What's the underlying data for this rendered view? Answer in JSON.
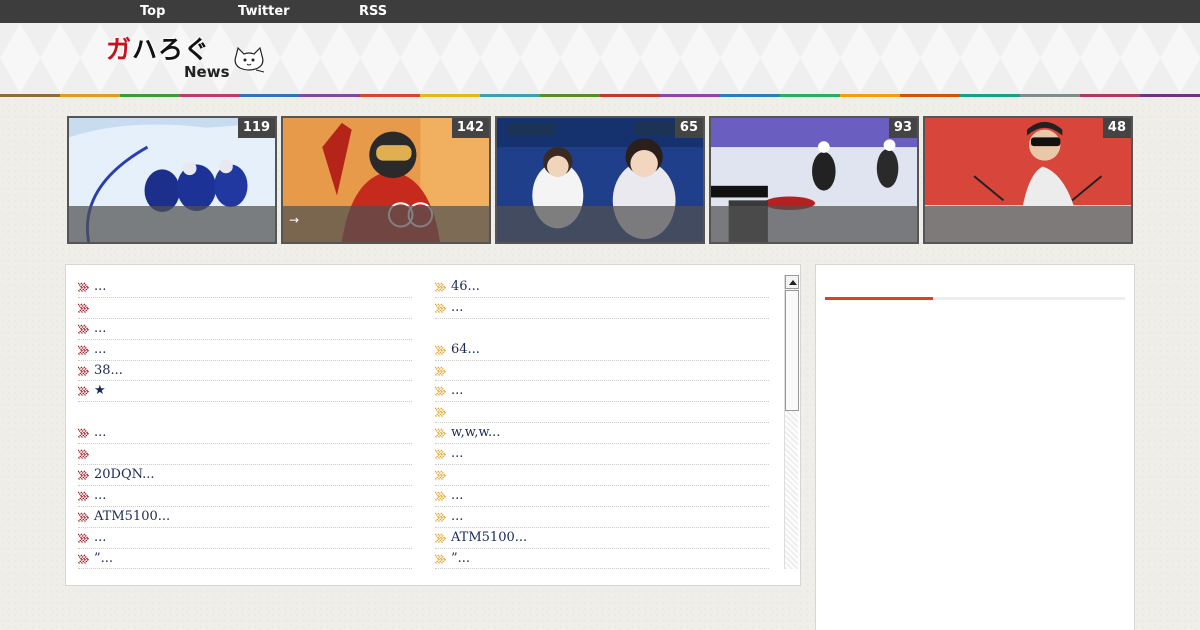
{
  "nav": {
    "items": [
      "Top",
      "Twitter",
      "RSS"
    ]
  },
  "logo": {
    "main_red": "ガ",
    "main_rest": "ハろぐ",
    "sub": "News"
  },
  "featured": [
    {
      "count": "119",
      "caption": ""
    },
    {
      "count": "142",
      "caption": "→"
    },
    {
      "count": "65",
      "caption": ""
    },
    {
      "count": "93",
      "caption": ""
    },
    {
      "count": "48",
      "caption": ""
    }
  ],
  "list": {
    "left": [
      "...",
      "",
      "...",
      "...",
      "38...",
      "★",
      "",
      "...",
      "",
      "20DQN...",
      "...",
      "ATM5100...",
      "...",
      "”..."
    ],
    "right": [
      "46...",
      "...",
      "",
      "64...",
      "",
      "...",
      "",
      "w,w,w...",
      "...",
      "",
      "...",
      "...",
      "ATM5100...",
      "”..."
    ]
  },
  "colors": {
    "left_arrow": "#a0141f",
    "right_arrow": "#e0a020",
    "accent": "#e0401a"
  }
}
